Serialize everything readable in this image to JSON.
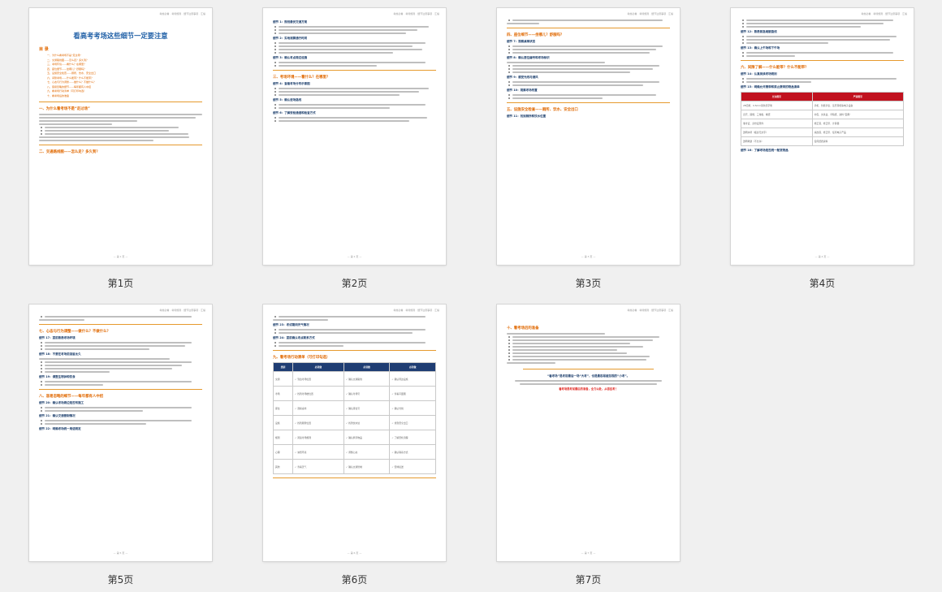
{
  "doc_header": "考前必看 · 考场规则 · 细节注意事项 · 汇编",
  "pages": [
    {
      "caption": "第1页",
      "footer": "— 第 1 页 —"
    },
    {
      "caption": "第2页",
      "footer": "— 第 2 页 —"
    },
    {
      "caption": "第3页",
      "footer": "— 第 3 页 —"
    },
    {
      "caption": "第4页",
      "footer": "— 第 4 页 —"
    },
    {
      "caption": "第5页",
      "footer": "— 第 5 页 —"
    },
    {
      "caption": "第6页",
      "footer": "— 第 6 页 —"
    },
    {
      "caption": "第7页",
      "footer": "— 第 7 页 —"
    }
  ],
  "p1": {
    "title": "看高考考场这些细节一定要注意",
    "toc_title": "目 录",
    "toc": [
      "一、为什么看考场不是“走过场”",
      "二、交通路线图——怎么走？多久到？",
      "三、考场环境——看什么？在哪里？",
      "四、座位细节——坐哪儿？舒服吗？",
      "五、设施安全检查——厕所、饮水、安全出口",
      "六、间隙考场——什么能带？什么不能带？",
      "七、心态与行为调整——做什么？不做什么？",
      "八、容易忽略的细节——每年都有人中招",
      "九、看考场行动清单（可打印勾选）",
      "十、看考场后的准备"
    ],
    "h1": "一、为什么看考场不是“走过场”",
    "h1b": "二、交通路线图——怎么走？多久到？"
  },
  "p2": {
    "h2a": "细节 1：规划最优交通方案",
    "h2b": "细节 2：实地测算通行时间",
    "h2c": "细节 3：确认考点周边设施",
    "h1": "三、考场环境——看什么？在哪里？",
    "h2d": "细节 4：查看考场分布示意图",
    "h2e": "细节 5：确认进场路线",
    "h2f": "细节 6：了解安检通道和检查方式"
  },
  "p3": {
    "h1": "四、座位细节——坐哪儿？舒服吗？",
    "h2a": "细节 7：观察桌椅状态",
    "h2b": "细节 8：确认座位编号和考场标识",
    "h2c": "细节 9：感受光线与通风",
    "h2d": "细节 10：观察考场布置",
    "h1b": "五、设施安全检查——厕所、饮水、安全出口",
    "h2e": "细节 11：找到厕所和饮水位置"
  },
  "p4": {
    "h2a": "细节 12：熟悉紧急疏散路线",
    "h2b": "细节 13：确认上午场和下午场",
    "h1": "六、间隙了解——什么能带？什么不能带？",
    "h2c": "细节 14：认真阅读考场规则",
    "h2d": "细节 15：明确允许携带和禁止携带的物品清单",
    "table_headers": [
      "允许携带",
      "严禁携带"
    ],
    "table_rows": [
      [
        "2B铅笔、0.5mm黑色签字笔",
        "手机、智能手表、蓝牙耳机等电子设备"
      ],
      [
        "直尺、圆规、三角板、橡皮",
        "书包、文具盒、草稿纸、资料“宝典”"
      ],
      [
        "准考证、身份证原件",
        "修正液、修正带、计算器"
      ],
      [
        "透明水杯（瓶身无文字）",
        "涂改液、修正带、任何电子产品"
      ],
      [
        "透明笔袋（不允许）",
        "任何纸质资料"
      ]
    ],
    "h2e": "细节 16：了解考场是否统一配发物品"
  },
  "p5": {
    "h1": "七、心态与行为调整——做什么？不做什么？",
    "h2a": "细节 17：提前熟悉考场环境",
    "h2b": "细节 18：不要在考场前逗留太久",
    "h2c": "细节 19：调整生物钟和饮食",
    "h1b": "八、容易忽略的细节——每年都有人中招",
    "h2d": "细节 20：确认考场周边是否有施工",
    "h2e": "细节 21：确认交通管制情况",
    "h2f": "细节 22：明确考场统一用语规定"
  },
  "p6": {
    "h2a": "细节 23：考试期间天气情况",
    "h2b": "细节 24：提前确认考点联系方式",
    "h1": "九、看考场行动清单（可打印勾选）",
    "table_headers": [
      "类别",
      "必须做",
      "必须做",
      "必须做"
    ],
    "table_rows": [
      [
        "交通",
        "✓ 到达考场位置",
        "✓ 确认交通路线",
        "✓ 确认周边设施"
      ],
      [
        "考场",
        "✓ 找到考场楼位置",
        "✓ 确认考场号",
        "✓ 查看平面图"
      ],
      [
        "座位",
        "✓ 观察桌椅",
        "✓ 确认座位号",
        "✓ 确认光线"
      ],
      [
        "设施",
        "✓ 找到厕所位置",
        "✓ 找到饮水处",
        "✓ 找到安全出口"
      ],
      [
        "规则",
        "✓ 阅读考场规则",
        "✓ 确认携带物品",
        "✓ 了解安检流程"
      ],
      [
        "心理",
        "✓ 熟悉环境",
        "✓ 调整心态",
        "✓ 确认联系方式"
      ],
      [
        "其他",
        "✓ 查看天气",
        "✓ 确认交通管制",
        "✓ 安排接送"
      ]
    ]
  },
  "p7": {
    "h1": "十、看考场后的准备",
    "callout": "“看考场”是考前最后一场“大考”，也是最容易被忽视的“小考”。",
    "callout_red": "看考场是考前最后的准备，全力以赴，从容应考！"
  }
}
